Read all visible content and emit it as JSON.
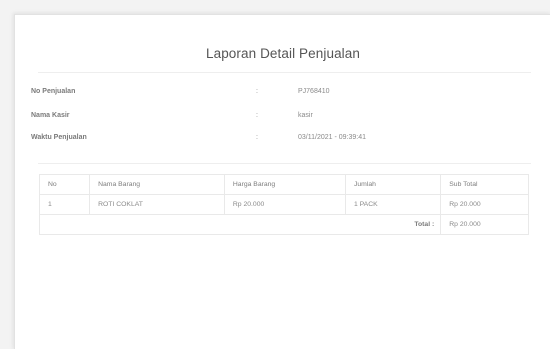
{
  "report": {
    "title": "Laporan Detail Penjualan"
  },
  "info": [
    {
      "label": "No Penjualan",
      "colon": ":",
      "value": "PJ768410"
    },
    {
      "label": "Nama Kasir",
      "colon": ":",
      "value": "kasir"
    },
    {
      "label": "Waktu Penjualan",
      "colon": ":",
      "value": "03/11/2021 - 09:39:41"
    }
  ],
  "table": {
    "headers": [
      "No",
      "Nama Barang",
      "Harga Barang",
      "Jumlah",
      "Sub Total"
    ],
    "rows": [
      [
        "1",
        "ROTI COKLAT",
        "Rp 20.000",
        "1 PACK",
        "Rp 20.000"
      ]
    ],
    "total_label": "Total :",
    "total_value": "Rp 20.000"
  }
}
